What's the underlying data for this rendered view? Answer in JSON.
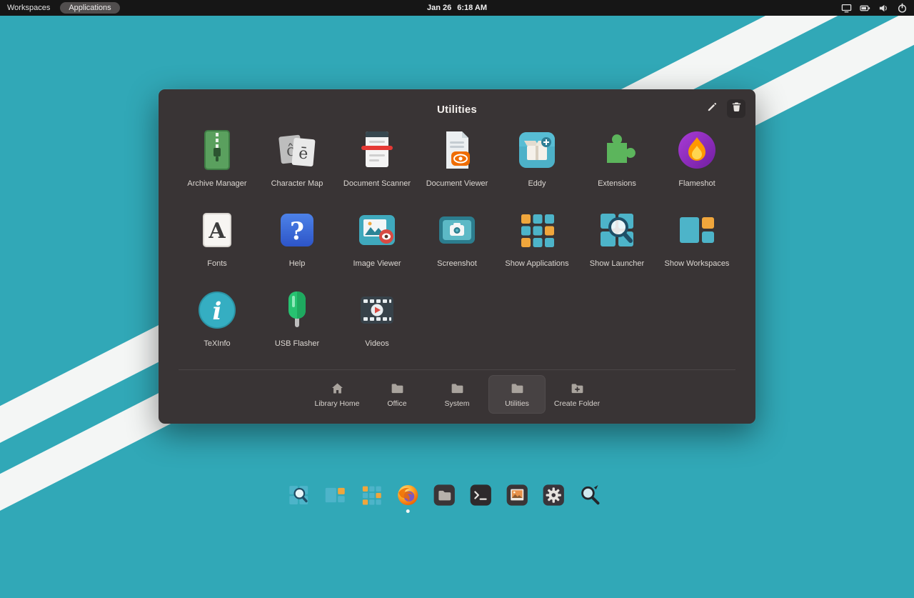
{
  "panel": {
    "workspaces_label": "Workspaces",
    "applications_label": "Applications",
    "clock": {
      "date": "Jan 26",
      "time": "6:18 AM"
    },
    "indicators": [
      {
        "icon": "display-icon"
      },
      {
        "icon": "battery-icon"
      },
      {
        "icon": "volume-icon"
      },
      {
        "icon": "power-icon"
      }
    ]
  },
  "folder_dialog": {
    "title": "Utilities",
    "actions": [
      {
        "name": "edit-folder-button",
        "icon": "edit-icon"
      },
      {
        "name": "delete-folder-button",
        "icon": "trash-icon"
      }
    ],
    "apps": [
      {
        "label": "Archive Manager",
        "icon": "archive-manager-icon"
      },
      {
        "label": "Character Map",
        "icon": "character-map-icon"
      },
      {
        "label": "Document Scanner",
        "icon": "document-scanner-icon"
      },
      {
        "label": "Document Viewer",
        "icon": "document-viewer-icon"
      },
      {
        "label": "Eddy",
        "icon": "eddy-icon"
      },
      {
        "label": "Extensions",
        "icon": "extensions-icon"
      },
      {
        "label": "Flameshot",
        "icon": "flameshot-icon"
      },
      {
        "label": "Fonts",
        "icon": "fonts-icon"
      },
      {
        "label": "Help",
        "icon": "help-icon"
      },
      {
        "label": "Image Viewer",
        "icon": "image-viewer-icon"
      },
      {
        "label": "Screenshot",
        "icon": "screenshot-icon"
      },
      {
        "label": "Show Applications",
        "icon": "show-applications-icon"
      },
      {
        "label": "Show Launcher",
        "icon": "show-launcher-icon"
      },
      {
        "label": "Show Workspaces",
        "icon": "show-workspaces-icon"
      },
      {
        "label": "TeXInfo",
        "icon": "texinfo-icon"
      },
      {
        "label": "USB Flasher",
        "icon": "usb-flasher-icon"
      },
      {
        "label": "Videos",
        "icon": "videos-icon"
      }
    ],
    "tabs": [
      {
        "label": "Library Home",
        "icon": "home-icon",
        "selected": false
      },
      {
        "label": "Office",
        "icon": "folder-icon",
        "selected": false
      },
      {
        "label": "System",
        "icon": "folder-icon",
        "selected": false
      },
      {
        "label": "Utilities",
        "icon": "folder-icon",
        "selected": true
      },
      {
        "label": "Create Folder",
        "icon": "folder-plus-icon",
        "selected": false
      }
    ]
  },
  "dock": {
    "items": [
      {
        "name": "show-launcher",
        "icon": "show-launcher-icon",
        "running": false
      },
      {
        "name": "show-workspaces",
        "icon": "show-workspaces-icon",
        "running": false
      },
      {
        "name": "show-applications",
        "icon": "show-applications-icon",
        "running": false
      },
      {
        "name": "firefox",
        "icon": "firefox-icon",
        "running": true
      },
      {
        "name": "files",
        "icon": "files-icon",
        "running": false
      },
      {
        "name": "terminal",
        "icon": "terminal-icon",
        "running": false
      },
      {
        "name": "photos",
        "icon": "photos-icon",
        "running": false
      },
      {
        "name": "settings",
        "icon": "settings-icon",
        "running": false
      },
      {
        "name": "screenshot-tool",
        "icon": "screenshot-tool-icon",
        "running": false
      }
    ]
  },
  "colors": {
    "desktop": "#31a8b7",
    "stripe": "#f4f6f5",
    "panel": "#161616",
    "dialog": "#393435",
    "accent_teal": "#4db4c9",
    "accent_orange": "#f0a63c"
  }
}
